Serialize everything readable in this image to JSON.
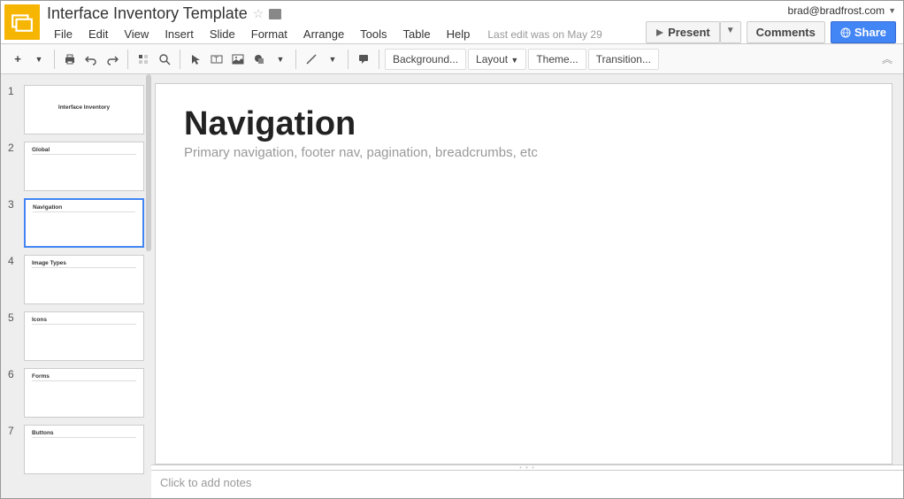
{
  "header": {
    "doc_title": "Interface Inventory Template",
    "account_email": "brad@bradfrost.com",
    "present_label": "Present",
    "comments_label": "Comments",
    "share_label": "Share",
    "last_edit": "Last edit was on May 29",
    "menu": [
      "File",
      "Edit",
      "View",
      "Insert",
      "Slide",
      "Format",
      "Arrange",
      "Tools",
      "Table",
      "Help"
    ]
  },
  "toolbar": {
    "labels": [
      "Background...",
      "Layout",
      "Theme...",
      "Transition..."
    ]
  },
  "sidebar": {
    "slides": [
      {
        "num": "1",
        "title": "Interface Inventory",
        "center": true
      },
      {
        "num": "2",
        "title": "Global",
        "center": false
      },
      {
        "num": "3",
        "title": "Navigation",
        "center": false,
        "selected": true
      },
      {
        "num": "4",
        "title": "Image Types",
        "center": false
      },
      {
        "num": "5",
        "title": "Icons",
        "center": false
      },
      {
        "num": "6",
        "title": "Forms",
        "center": false
      },
      {
        "num": "7",
        "title": "Buttons",
        "center": false
      }
    ]
  },
  "slide": {
    "title": "Navigation",
    "subtitle": "Primary navigation, footer nav, pagination, breadcrumbs, etc"
  },
  "notes": {
    "placeholder": "Click to add notes"
  }
}
